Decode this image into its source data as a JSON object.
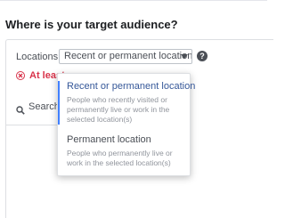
{
  "section": {
    "heading": "Where is your target audience?"
  },
  "locations": {
    "label": "Locations",
    "selected_value": "Recent or permanent location",
    "help_icon_glyph": "?"
  },
  "error": {
    "text": "At least",
    "color": "#d8334a"
  },
  "search": {
    "text": "Search"
  },
  "dropdown": {
    "options": [
      {
        "title": "Recent or permanent location",
        "description": "People who recently visited or permanently live or work in the selected location(s)",
        "selected": true
      },
      {
        "title": "Permanent location",
        "description": "People who permanently live or work in the selected location(s)",
        "selected": false
      }
    ]
  },
  "colors": {
    "accent_blue": "#4080ff",
    "selected_text": "#365899",
    "error_red": "#d8334a"
  }
}
